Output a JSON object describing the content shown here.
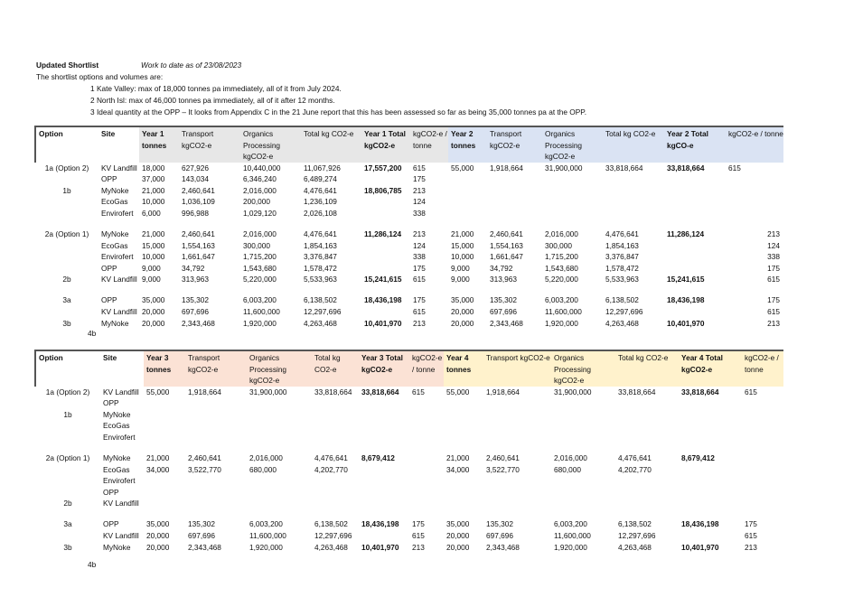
{
  "intro": {
    "title": "Updated Shortlist",
    "subtitle": "Work to date as of 23/08/2023",
    "lead": "The shortlist options and volumes are:",
    "items": [
      {
        "num": "1",
        "text": "Kate Valley: max of 18,000 tonnes pa immediately, all of it from July 2024."
      },
      {
        "num": "2",
        "text": " North Isl: max of 46,000 tonnes pa immediately, all of it after 12 months."
      },
      {
        "num": "3",
        "text": "Ideal quantity at the OPP – It looks from Appendix C in the 21 June report that this has been assessed so far as being 35,000 tonnes pa at the OPP."
      }
    ]
  },
  "colors": {
    "header_grey": "#e7e7e7",
    "year2_blue": "#dae3f3",
    "year3_peach": "#fbe2d5",
    "year4_yellow": "#fff2cc"
  },
  "table1": {
    "headers": [
      "Option",
      "Site",
      "Year 1 tonnes",
      "Transport kgCO2-e",
      "Organics Processing kgCO2-e",
      "Total kg CO2-e",
      "Year 1 Total kgCO2-e",
      "kgCO2-e / tonne",
      "Year 2 tonnes",
      "Transport kgCO2-e",
      "Organics Processing kgCO2-e",
      "Total kg CO2-e",
      "Year 2 Total kgCO-e",
      "kgCO2-e / tonne"
    ],
    "rows": [
      [
        "1a (Option 2)",
        "KV Landfill",
        "18,000",
        "627,926",
        "10,440,000",
        "11,067,926",
        "17,557,200",
        "615",
        "55,000",
        "1,918,664",
        "31,900,000",
        "33,818,664",
        "33,818,664",
        "615"
      ],
      [
        "",
        "OPP",
        "37,000",
        "143,034",
        "6,346,240",
        "6,489,274",
        "",
        "175",
        "",
        "",
        "",
        "",
        "",
        ""
      ],
      [
        "1b",
        "MyNoke",
        "21,000",
        "2,460,641",
        "2,016,000",
        "4,476,641",
        "18,806,785",
        "213",
        "",
        "",
        "",
        "",
        "",
        ""
      ],
      [
        "",
        "EcoGas",
        "10,000",
        "1,036,109",
        "200,000",
        "1,236,109",
        "",
        "124",
        "",
        "",
        "",
        "",
        "",
        ""
      ],
      [
        "",
        "Envirofert",
        "6,000",
        "996,988",
        "1,029,120",
        "2,026,108",
        "",
        "338",
        "",
        "",
        "",
        "",
        "",
        ""
      ],
      [],
      [
        "2a (Option 1)",
        "MyNoke",
        "21,000",
        "2,460,641",
        "2,016,000",
        "4,476,641",
        "11,286,124",
        "213",
        "21,000",
        "2,460,641",
        "2,016,000",
        "4,476,641",
        "11,286,124",
        "213"
      ],
      [
        "",
        "EcoGas",
        "15,000",
        "1,554,163",
        "300,000",
        "1,854,163",
        "",
        "124",
        "15,000",
        "1,554,163",
        "300,000",
        "1,854,163",
        "",
        "124"
      ],
      [
        "",
        "Envirofert",
        "10,000",
        "1,661,647",
        "1,715,200",
        "3,376,847",
        "",
        "338",
        "10,000",
        "1,661,647",
        "1,715,200",
        "3,376,847",
        "",
        "338"
      ],
      [
        "",
        "OPP",
        "9,000",
        "34,792",
        "1,543,680",
        "1,578,472",
        "",
        "175",
        "9,000",
        "34,792",
        "1,543,680",
        "1,578,472",
        "",
        "175"
      ],
      [
        "2b",
        "KV Landfill",
        "9,000",
        "313,963",
        "5,220,000",
        "5,533,963",
        "15,241,615",
        "615",
        "9,000",
        "313,963",
        "5,220,000",
        "5,533,963",
        "15,241,615",
        "615"
      ],
      [],
      [
        "3a",
        "OPP",
        "35,000",
        "135,302",
        "6,003,200",
        "6,138,502",
        "18,436,198",
        "175",
        "35,000",
        "135,302",
        "6,003,200",
        "6,138,502",
        "18,436,198",
        "175"
      ],
      [
        "",
        "KV Landfill",
        "20,000",
        "697,696",
        "11,600,000",
        "12,297,696",
        "",
        "615",
        "20,000",
        "697,696",
        "11,600,000",
        "12,297,696",
        "",
        "615"
      ],
      [
        "3b",
        "MyNoke",
        "20,000",
        "2,343,468",
        "1,920,000",
        "4,263,468",
        "10,401,970",
        "213",
        "20,000",
        "2,343,468",
        "1,920,000",
        "4,263,468",
        "10,401,970",
        "213"
      ]
    ],
    "footnote": "4b"
  },
  "table2": {
    "headers": [
      "Option",
      "Site",
      "Year 3 tonnes",
      "Transport kgCO2-e",
      "Organics Processing kgCO2-e",
      "Total kg CO2-e",
      "Year 3 Total kgCO2-e",
      "kgCO2-e / tonne",
      "Year 4 tonnes",
      "Transport kgCO2-e",
      "Organics Processing kgCO2-e",
      "Total kg CO2-e",
      "Year 4 Total kgCO2-e",
      "kgCO2-e / tonne"
    ],
    "rows": [
      [
        "1a (Option 2)",
        "KV Landfill",
        "55,000",
        "1,918,664",
        "31,900,000",
        "33,818,664",
        "33,818,664",
        "615",
        "55,000",
        "1,918,664",
        "31,900,000",
        "33,818,664",
        "33,818,664",
        "615"
      ],
      [
        "",
        "OPP"
      ],
      [
        "1b",
        "MyNoke"
      ],
      [
        "",
        "EcoGas"
      ],
      [
        "",
        "Envirofert"
      ],
      [],
      [
        "2a (Option 1)",
        "MyNoke",
        "21,000",
        "2,460,641",
        "2,016,000",
        "4,476,641",
        "8,679,412",
        "",
        "21,000",
        "2,460,641",
        "2,016,000",
        "4,476,641",
        "8,679,412",
        ""
      ],
      [
        "",
        "EcoGas",
        "34,000",
        "3,522,770",
        "680,000",
        "4,202,770",
        "",
        "",
        "34,000",
        "3,522,770",
        "680,000",
        "4,202,770",
        "",
        ""
      ],
      [
        "",
        "Envirofert"
      ],
      [
        "",
        "OPP"
      ],
      [
        "2b",
        "KV Landfill"
      ],
      [],
      [
        "3a",
        "OPP",
        "35,000",
        "135,302",
        "6,003,200",
        "6,138,502",
        "18,436,198",
        "175",
        "35,000",
        "135,302",
        "6,003,200",
        "6,138,502",
        "18,436,198",
        "175"
      ],
      [
        "",
        "KV Landfill",
        "20,000",
        "697,696",
        "11,600,000",
        "12,297,696",
        "",
        "615",
        "20,000",
        "697,696",
        "11,600,000",
        "12,297,696",
        "",
        "615"
      ],
      [
        "3b",
        "MyNoke",
        "20,000",
        "2,343,468",
        "1,920,000",
        "4,263,468",
        "10,401,970",
        "213",
        "20,000",
        "2,343,468",
        "1,920,000",
        "4,263,468",
        "10,401,970",
        "213"
      ]
    ],
    "footnote": "4b"
  }
}
